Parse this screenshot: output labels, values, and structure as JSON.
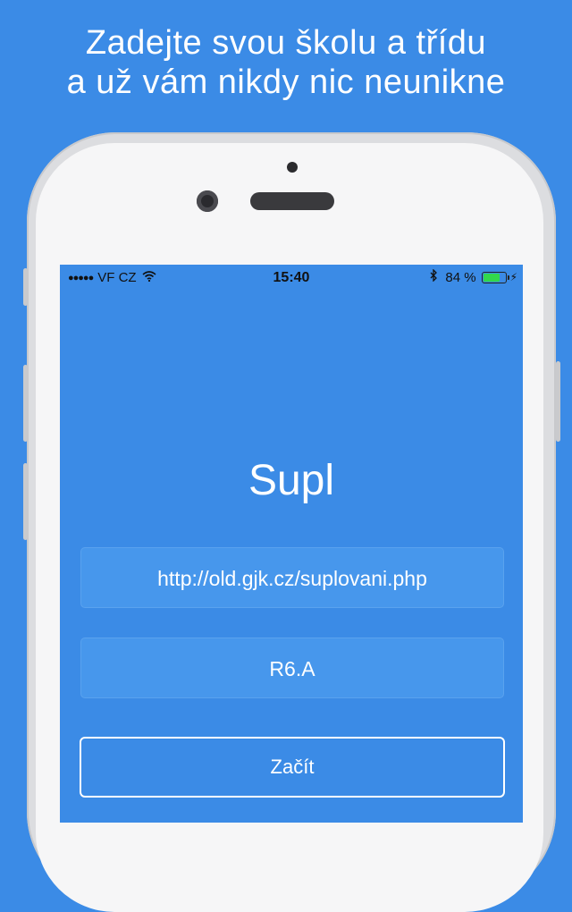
{
  "promo": {
    "line1": "Zadejte svou školu a třídu",
    "line2": "a už vám nikdy nic neunikne"
  },
  "status_bar": {
    "signal_dots": "●●●●●",
    "carrier": "VF CZ",
    "time": "15:40",
    "battery_percent_text": "84 %",
    "battery_level": 0.84,
    "battery_color": "#32d74b"
  },
  "app": {
    "title": "Supl",
    "school_url": "http://old.gjk.cz/suplovani.php",
    "class_name": "R6.A",
    "start_label": "Začít"
  },
  "colors": {
    "background": "#3b8be6",
    "field": "#4797ec",
    "text": "#ffffff"
  }
}
